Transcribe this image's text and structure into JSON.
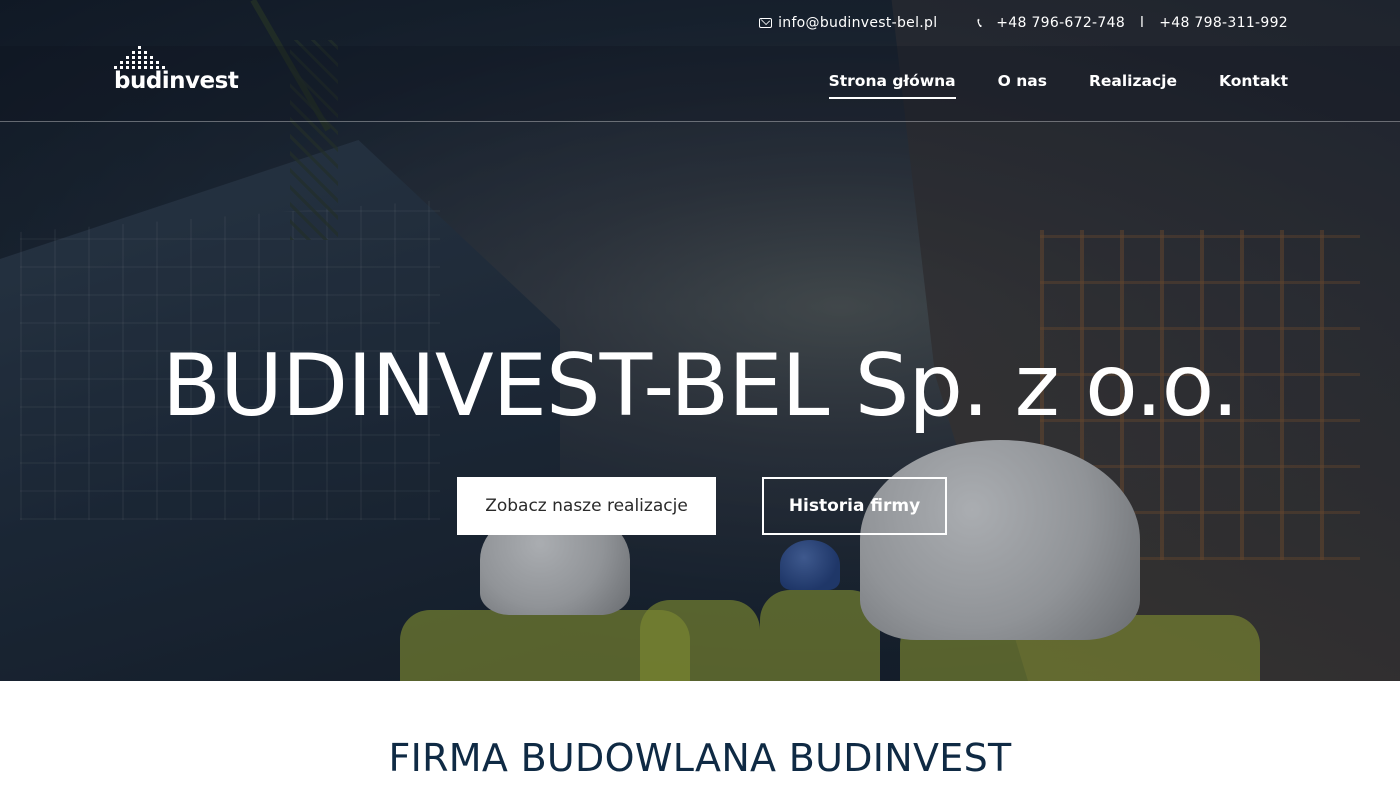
{
  "topbar": {
    "email": "info@budinvest-bel.pl",
    "phone1": "+48 796-672-748",
    "separator": "l",
    "phone2": "+48 798-311-992"
  },
  "brand": {
    "logo_text": "budinvest"
  },
  "nav": {
    "items": [
      {
        "label": "Strona główna",
        "active": true
      },
      {
        "label": "O nas",
        "active": false
      },
      {
        "label": "Realizacje",
        "active": false
      },
      {
        "label": "Kontakt",
        "active": false
      }
    ]
  },
  "hero": {
    "title": "BUDINVEST-BEL Sp. z o.o.",
    "primary_button": "Zobacz nasze realizacje",
    "secondary_button": "Historia firmy"
  },
  "section": {
    "title": "FIRMA BUDOWLANA BUDINVEST"
  },
  "colors": {
    "accent": "#ffffff",
    "heading": "#0f2a44"
  },
  "icons": {
    "email": "envelope-icon",
    "phone": "phone-icon"
  }
}
